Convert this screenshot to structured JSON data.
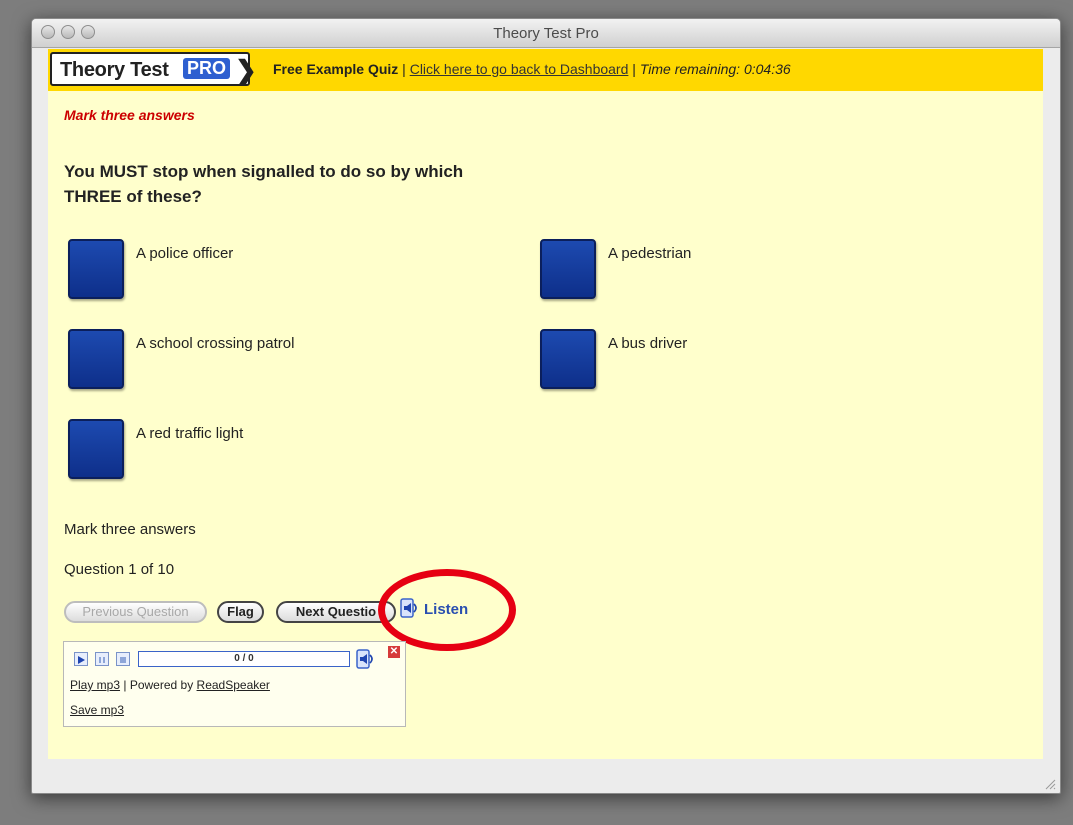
{
  "window": {
    "title": "Theory Test Pro"
  },
  "header": {
    "logo_text": "Theory Test",
    "logo_badge": "PRO",
    "quiz_label": "Free Example Quiz",
    "separator": "|",
    "dashboard_link": "Click here to go back to Dashboard",
    "time_remaining": "Time remaining: 0:04:36"
  },
  "quiz": {
    "instruction": "Mark three answers",
    "question": "You MUST stop when signalled to do so by which THREE of these?",
    "answers": [
      {
        "label": "A police officer",
        "checked": false
      },
      {
        "label": "A pedestrian",
        "checked": false
      },
      {
        "label": "A school crossing patrol",
        "checked": false
      },
      {
        "label": "A bus driver",
        "checked": false
      },
      {
        "label": "A red traffic light",
        "checked": false
      }
    ],
    "footer_instruction": "Mark three answers",
    "progress": "Question 1 of 10"
  },
  "nav": {
    "previous_label": "Previous Question",
    "flag_label": "Flag",
    "next_label": "Next Questio",
    "listen_label": "Listen"
  },
  "player": {
    "time_display": "0 / 0",
    "play_mp3": "Play mp3",
    "powered_by": "| Powered by",
    "readspeaker": "ReadSpeaker",
    "save_mp3": "Save mp3"
  },
  "colors": {
    "header_bg": "#ffd800",
    "page_bg": "#ffffcc",
    "checkbox": "#1d4ab0",
    "instruction_red": "#cc0000",
    "highlight_ring": "#e60012"
  }
}
